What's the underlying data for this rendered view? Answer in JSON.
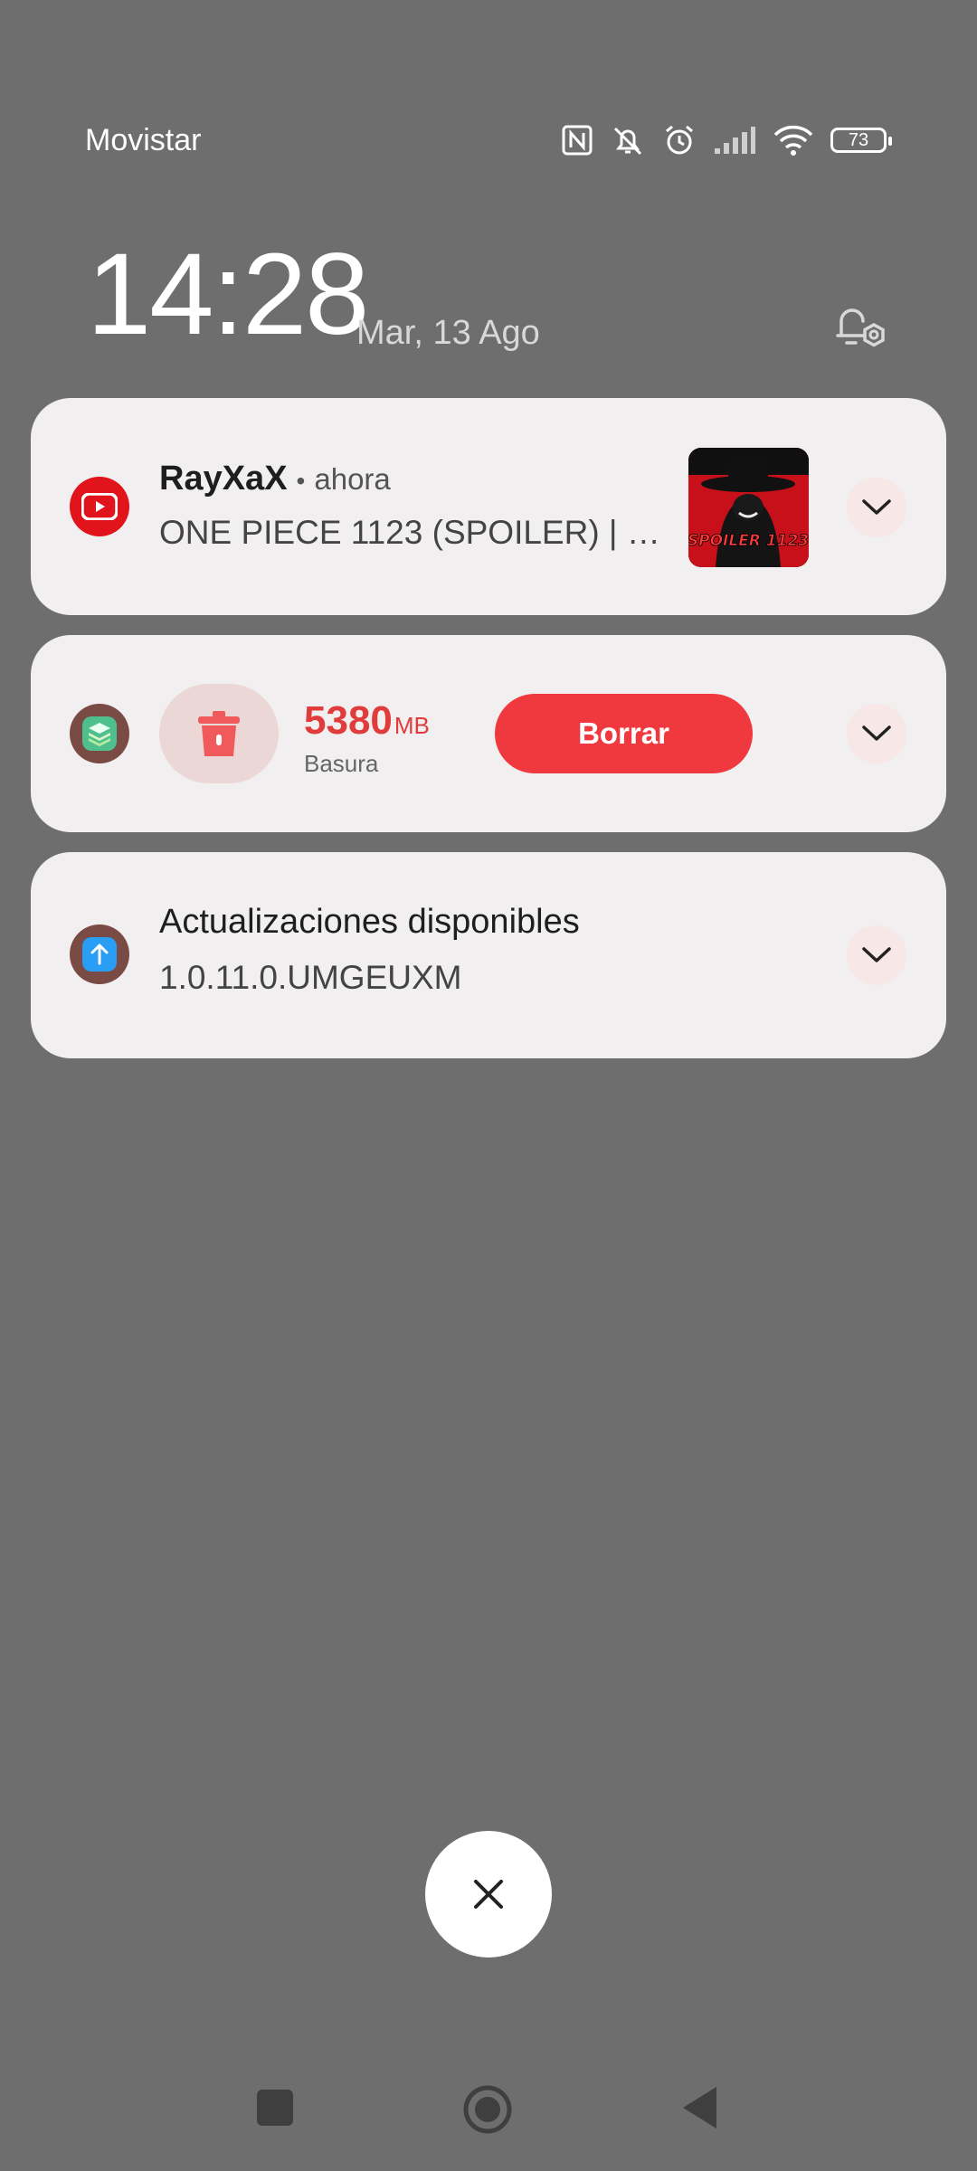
{
  "status_bar": {
    "carrier": "Movistar",
    "battery_level": "73",
    "icons": [
      "nfc-icon",
      "bell-muted-icon",
      "alarm-icon",
      "signal-icon",
      "wifi-icon",
      "battery-icon"
    ]
  },
  "lockscreen": {
    "time": "14:28",
    "date": "Mar, 13 Ago"
  },
  "notifications": [
    {
      "app_icon": "youtube-icon",
      "sender": "RayXaX",
      "separator": "•",
      "time": "ahora",
      "message": "ONE PIECE 1123 (SPOILER) | …",
      "thumbnail_text": "SPOILER 1123"
    },
    {
      "app_icon": "cleaner-icon",
      "size_value": "5380",
      "size_unit": "MB",
      "size_label": "Basura",
      "action_label": "Borrar"
    },
    {
      "app_icon": "update-icon",
      "title": "Actualizaciones disponibles",
      "subtitle": "1.0.11.0.UMGEUXM"
    }
  ],
  "colors": {
    "background": "#6e6e6e",
    "card": "#f1efef",
    "accent_red": "#f0393e",
    "size_red": "#e13c3c"
  }
}
